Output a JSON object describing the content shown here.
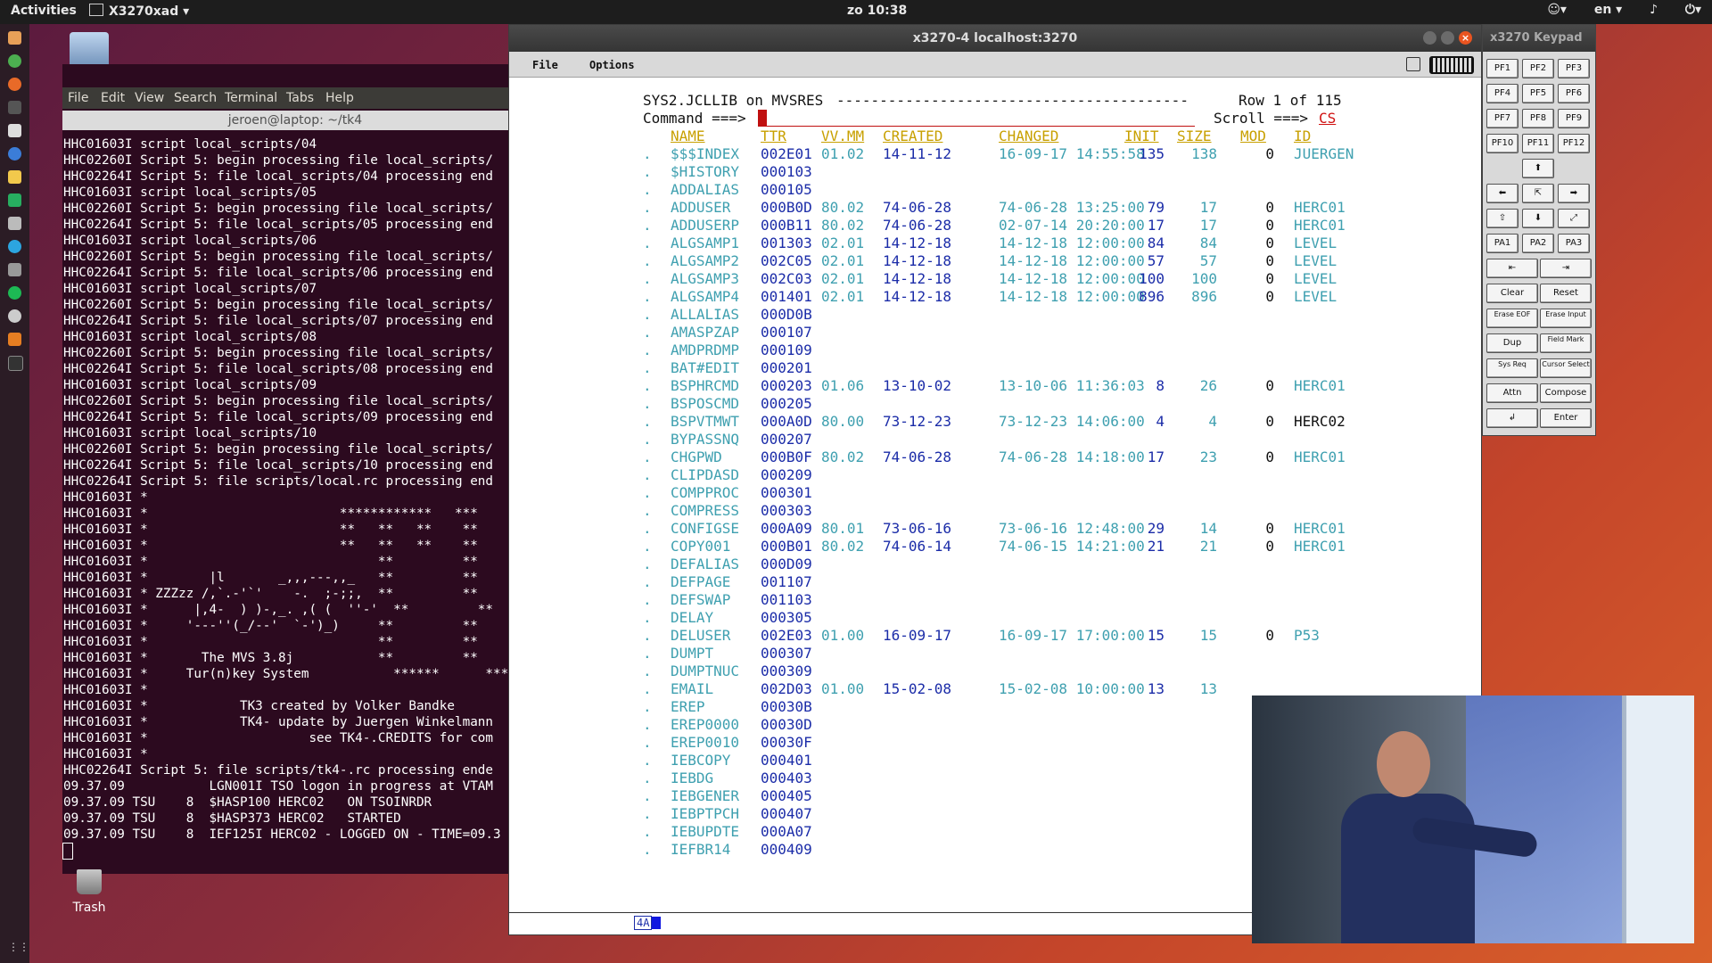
{
  "topbar": {
    "activities": "Activities",
    "app_name": "X3270xad ▾",
    "clock": "zo 10:38",
    "lang": "en ▾"
  },
  "desktop": {
    "trash_label": "Trash"
  },
  "terminal": {
    "menu": [
      "File",
      "Edit",
      "View",
      "Search",
      "Terminal",
      "Tabs",
      "Help"
    ],
    "title": "jeroen@laptop: ~/tk4",
    "lines": [
      "HHC01603I script local_scripts/04",
      "HHC02260I Script 5: begin processing file local_scripts/",
      "HHC02264I Script 5: file local_scripts/04 processing end",
      "HHC01603I script local_scripts/05",
      "HHC02260I Script 5: begin processing file local_scripts/",
      "HHC02264I Script 5: file local_scripts/05 processing end",
      "HHC01603I script local_scripts/06",
      "HHC02260I Script 5: begin processing file local_scripts/",
      "HHC02264I Script 5: file local_scripts/06 processing end",
      "HHC01603I script local_scripts/07",
      "HHC02260I Script 5: begin processing file local_scripts/",
      "HHC02264I Script 5: file local_scripts/07 processing end",
      "HHC01603I script local_scripts/08",
      "HHC02260I Script 5: begin processing file local_scripts/",
      "HHC02264I Script 5: file local_scripts/08 processing end",
      "HHC01603I script local_scripts/09",
      "HHC02260I Script 5: begin processing file local_scripts/",
      "HHC02264I Script 5: file local_scripts/09 processing end",
      "HHC01603I script local_scripts/10",
      "HHC02260I Script 5: begin processing file local_scripts/",
      "HHC02264I Script 5: file local_scripts/10 processing end",
      "HHC02264I Script 5: file scripts/local.rc processing end",
      "HHC01603I *",
      "HHC01603I *                         ************   ***",
      "HHC01603I *                         **   **   **    **",
      "HHC01603I *                         **   **   **    **",
      "HHC01603I *                              **         **",
      "HHC01603I *        |l       _,,,---,,_   **         **",
      "HHC01603I * ZZZzz /,`.-'`'    -.  ;-;;,  **         **",
      "HHC01603I *      |,4-  ) )-,_. ,( (  ''-'  **         **",
      "HHC01603I *     '---''(_/--'  `-')_)     **         **",
      "HHC01603I *                              **         **",
      "HHC01603I *       The MVS 3.8j           **         **",
      "HHC01603I *     Tur(n)key System           ******      ***",
      "HHC01603I *",
      "HHC01603I *            TK3 created by Volker Bandke",
      "HHC01603I *            TK4- update by Juergen Winkelmann",
      "HHC01603I *                     see TK4-.CREDITS for com",
      "HHC01603I *",
      "HHC02264I Script 5: file scripts/tk4-.rc processing ende",
      "09.37.09           LGN001I TSO logon in progress at VTAM",
      "09.37.09 TSU    8  $HASP100 HERC02   ON TSOINRDR",
      "09.37.09 TSU    8  $HASP373 HERC02   STARTED",
      "09.37.09 TSU    8  IEF125I HERC02 - LOGGED ON - TIME=09.3"
    ]
  },
  "x3270": {
    "title": "x3270-4 localhost:3270",
    "menu_file": "File",
    "menu_options": "Options",
    "header_left": "SYS2.JCLLIB on MVSRES",
    "header_dashes": "-----------------------------------------",
    "header_right": "Row 1 of 115",
    "command_label": "Command ===>",
    "scroll_label": "Scroll ===>",
    "scroll_value": "CS",
    "columns": [
      "NAME",
      "TTR",
      "VV.MM",
      "CREATED",
      "CHANGED",
      "INIT",
      "SIZE",
      "MOD",
      "ID"
    ],
    "members": [
      {
        "name": "$$$INDEX",
        "ttr": "002E01",
        "vv": "01.02",
        "created": "14-11-12",
        "changed": "16-09-17 14:55:58",
        "init": "135",
        "size": "138",
        "mod": "0",
        "id": "JUERGEN"
      },
      {
        "name": "$HISTORY",
        "ttr": "000103"
      },
      {
        "name": "ADDALIAS",
        "ttr": "000105"
      },
      {
        "name": "ADDUSER",
        "ttr": "000B0D",
        "vv": "80.02",
        "created": "74-06-28",
        "changed": "74-06-28 13:25:00",
        "init": "79",
        "size": "17",
        "mod": "0",
        "id": "HERC01"
      },
      {
        "name": "ADDUSERP",
        "ttr": "000B11",
        "vv": "80.02",
        "created": "74-06-28",
        "changed": "02-07-14 20:20:00",
        "init": "17",
        "size": "17",
        "mod": "0",
        "id": "HERC01"
      },
      {
        "name": "ALGSAMP1",
        "ttr": "001303",
        "vv": "02.01",
        "created": "14-12-18",
        "changed": "14-12-18 12:00:00",
        "init": "84",
        "size": "84",
        "mod": "0",
        "id": "LEVEL"
      },
      {
        "name": "ALGSAMP2",
        "ttr": "002C05",
        "vv": "02.01",
        "created": "14-12-18",
        "changed": "14-12-18 12:00:00",
        "init": "57",
        "size": "57",
        "mod": "0",
        "id": "LEVEL"
      },
      {
        "name": "ALGSAMP3",
        "ttr": "002C03",
        "vv": "02.01",
        "created": "14-12-18",
        "changed": "14-12-18 12:00:00",
        "init": "100",
        "size": "100",
        "mod": "0",
        "id": "LEVEL"
      },
      {
        "name": "ALGSAMP4",
        "ttr": "001401",
        "vv": "02.01",
        "created": "14-12-18",
        "changed": "14-12-18 12:00:00",
        "init": "896",
        "size": "896",
        "mod": "0",
        "id": "LEVEL"
      },
      {
        "name": "ALLALIAS",
        "ttr": "000D0B"
      },
      {
        "name": "AMASPZAP",
        "ttr": "000107"
      },
      {
        "name": "AMDPRDMP",
        "ttr": "000109"
      },
      {
        "name": "BAT#EDIT",
        "ttr": "000201"
      },
      {
        "name": "BSPHRCMD",
        "ttr": "000203",
        "vv": "01.06",
        "created": "13-10-02",
        "changed": "13-10-06 11:36:03",
        "init": "8",
        "size": "26",
        "mod": "0",
        "id": "HERC01"
      },
      {
        "name": "BSPOSCMD",
        "ttr": "000205"
      },
      {
        "name": "BSPVTMWT",
        "ttr": "000A0D",
        "vv": "80.00",
        "created": "73-12-23",
        "changed": "73-12-23 14:06:00",
        "init": "4",
        "size": "4",
        "mod": "0",
        "id": "HERC02"
      },
      {
        "name": "BYPASSNQ",
        "ttr": "000207"
      },
      {
        "name": "CHGPWD",
        "ttr": "000B0F",
        "vv": "80.02",
        "created": "74-06-28",
        "changed": "74-06-28 14:18:00",
        "init": "17",
        "size": "23",
        "mod": "0",
        "id": "HERC01"
      },
      {
        "name": "CLIPDASD",
        "ttr": "000209"
      },
      {
        "name": "COMPPROC",
        "ttr": "000301"
      },
      {
        "name": "COMPRESS",
        "ttr": "000303"
      },
      {
        "name": "CONFIGSE",
        "ttr": "000A09",
        "vv": "80.01",
        "created": "73-06-16",
        "changed": "73-06-16 12:48:00",
        "init": "29",
        "size": "14",
        "mod": "0",
        "id": "HERC01"
      },
      {
        "name": "COPY001",
        "ttr": "000B01",
        "vv": "80.02",
        "created": "74-06-14",
        "changed": "74-06-15 14:21:00",
        "init": "21",
        "size": "21",
        "mod": "0",
        "id": "HERC01"
      },
      {
        "name": "DEFALIAS",
        "ttr": "000D09"
      },
      {
        "name": "DEFPAGE",
        "ttr": "001107"
      },
      {
        "name": "DEFSWAP",
        "ttr": "001103"
      },
      {
        "name": "DELAY",
        "ttr": "000305"
      },
      {
        "name": "DELUSER",
        "ttr": "002E03",
        "vv": "01.00",
        "created": "16-09-17",
        "changed": "16-09-17 17:00:00",
        "init": "15",
        "size": "15",
        "mod": "0",
        "id": "P53"
      },
      {
        "name": "DUMPT",
        "ttr": "000307"
      },
      {
        "name": "DUMPTNUC",
        "ttr": "000309"
      },
      {
        "name": "EMAIL",
        "ttr": "002D03",
        "vv": "01.00",
        "created": "15-02-08",
        "changed": "15-02-08 10:00:00",
        "init": "13",
        "size": "13"
      },
      {
        "name": "EREP",
        "ttr": "00030B"
      },
      {
        "name": "EREP0000",
        "ttr": "00030D"
      },
      {
        "name": "EREP0010",
        "ttr": "00030F"
      },
      {
        "name": "IEBCOPY",
        "ttr": "000401"
      },
      {
        "name": "IEBDG",
        "ttr": "000403"
      },
      {
        "name": "IEBGENER",
        "ttr": "000405"
      },
      {
        "name": "IEBPTPCH",
        "ttr": "000407"
      },
      {
        "name": "IEBUPDTE",
        "ttr": "000A07"
      },
      {
        "name": "IEFBR14",
        "ttr": "000409"
      }
    ],
    "oia_status": "4A"
  },
  "keypad": {
    "title": "x3270 Keypad",
    "pf_keys": [
      "PF1",
      "PF2",
      "PF3",
      "PF4",
      "PF5",
      "PF6",
      "PF7",
      "PF8",
      "PF9",
      "PF10",
      "PF11",
      "PF12"
    ],
    "pa_keys": [
      "PA1",
      "PA2",
      "PA3"
    ],
    "arrows": {
      "up": "⬆",
      "left": "⬅",
      "home": "⇱",
      "right": "➡",
      "down": "⬇"
    },
    "tab_left": "⇤",
    "tab_right": "⇥",
    "fn_keys": [
      [
        "Clear",
        "Reset"
      ],
      [
        "Erase EOF",
        "Erase Input"
      ],
      [
        "Dup",
        "Field Mark"
      ],
      [
        "Sys Req",
        "Cursor Select"
      ],
      [
        "Attn",
        "Compose"
      ],
      [
        "↲",
        "Enter"
      ]
    ]
  },
  "colors": {
    "screen_bg": "#ffffff",
    "field_yellow": "#c8a000",
    "field_blue": "#1b2ca8",
    "field_cyan": "#3fa0b0",
    "cursor_red": "#c01010",
    "terminal_bg": "#2c0a1f"
  }
}
